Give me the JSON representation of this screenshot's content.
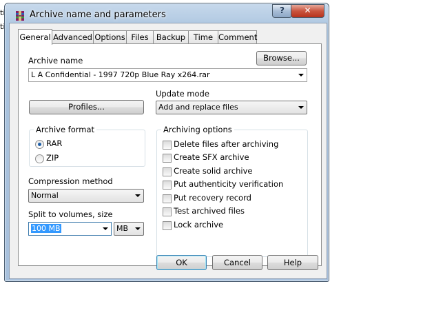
{
  "background": {
    "fragments": [
      "ti",
      "ti"
    ]
  },
  "window": {
    "title": "Archive name and parameters",
    "help_glyph": "?",
    "close_glyph": "✕"
  },
  "tabs": [
    {
      "label": "General",
      "active": true
    },
    {
      "label": "Advanced"
    },
    {
      "label": "Options"
    },
    {
      "label": "Files"
    },
    {
      "label": "Backup"
    },
    {
      "label": "Time"
    },
    {
      "label": "Comment"
    }
  ],
  "general": {
    "archive_name_label": "Archive name",
    "archive_name_value": "L A Confidential - 1997 720p Blue Ray x264.rar",
    "browse_label": "Browse...",
    "update_mode_label": "Update mode",
    "update_mode_value": "Add and replace files",
    "profiles_label": "Profiles...",
    "archive_format_label": "Archive format",
    "formats": [
      {
        "label": "RAR",
        "checked": true
      },
      {
        "label": "ZIP",
        "checked": false
      }
    ],
    "compression_label": "Compression method",
    "compression_value": "Normal",
    "split_label": "Split to volumes, size",
    "split_value": "100 MB",
    "split_unit": "MB",
    "archiving_options_label": "Archiving options",
    "options": [
      {
        "label": "Delete files after archiving",
        "checked": false
      },
      {
        "label": "Create SFX archive",
        "checked": false
      },
      {
        "label": "Create solid archive",
        "checked": false
      },
      {
        "label": "Put authenticity verification",
        "checked": false
      },
      {
        "label": "Put recovery record",
        "checked": false
      },
      {
        "label": "Test archived files",
        "checked": false
      },
      {
        "label": "Lock archive",
        "checked": false
      }
    ]
  },
  "footer": {
    "ok_label": "OK",
    "cancel_label": "Cancel",
    "help_label": "Help"
  },
  "colors": {
    "selection": "#3399ff",
    "radio_dot": "#1e5fa8",
    "default_button_border": "#3c7fb1"
  }
}
